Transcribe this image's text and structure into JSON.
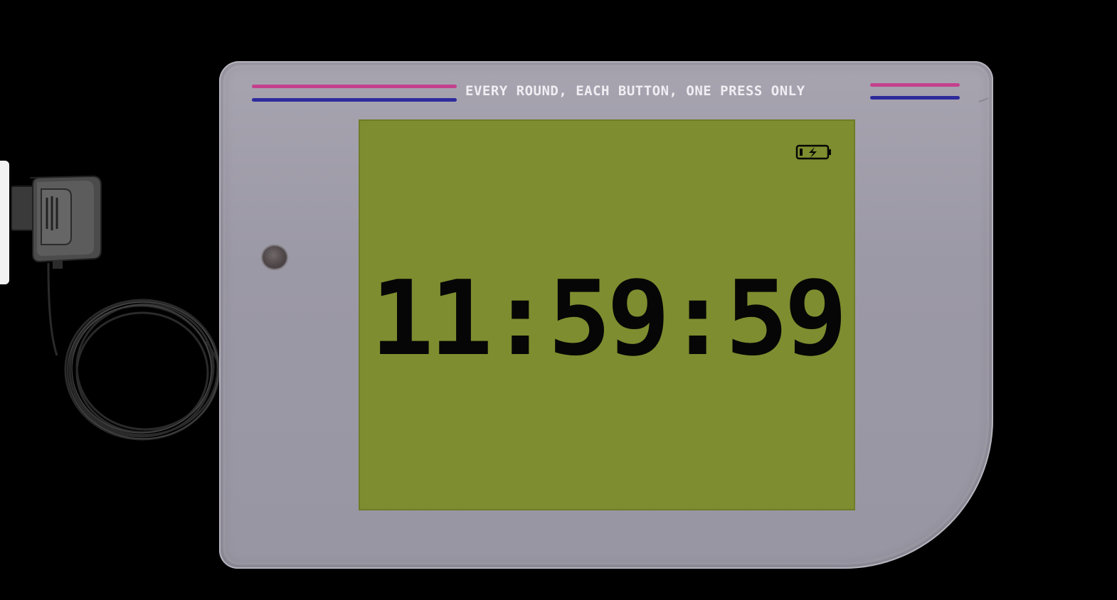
{
  "header": {
    "tagline": "EVERY ROUND, EACH BUTTON, ONE PRESS ONLY"
  },
  "screen": {
    "time": "11:59:59",
    "battery_icon": "battery-charging-icon"
  },
  "colors": {
    "background": "#000000",
    "console_body": "#9e9ba8",
    "screen_green": "#7e8d2f",
    "stripe_pink": "#c4408e",
    "stripe_blue": "#2e2b9c",
    "digit_color": "#060606",
    "header_text": "#f1eef3"
  },
  "icons": {
    "power_led": "power-led-icon",
    "adapter": "power-adapter-icon",
    "cable": "cable-icon"
  }
}
